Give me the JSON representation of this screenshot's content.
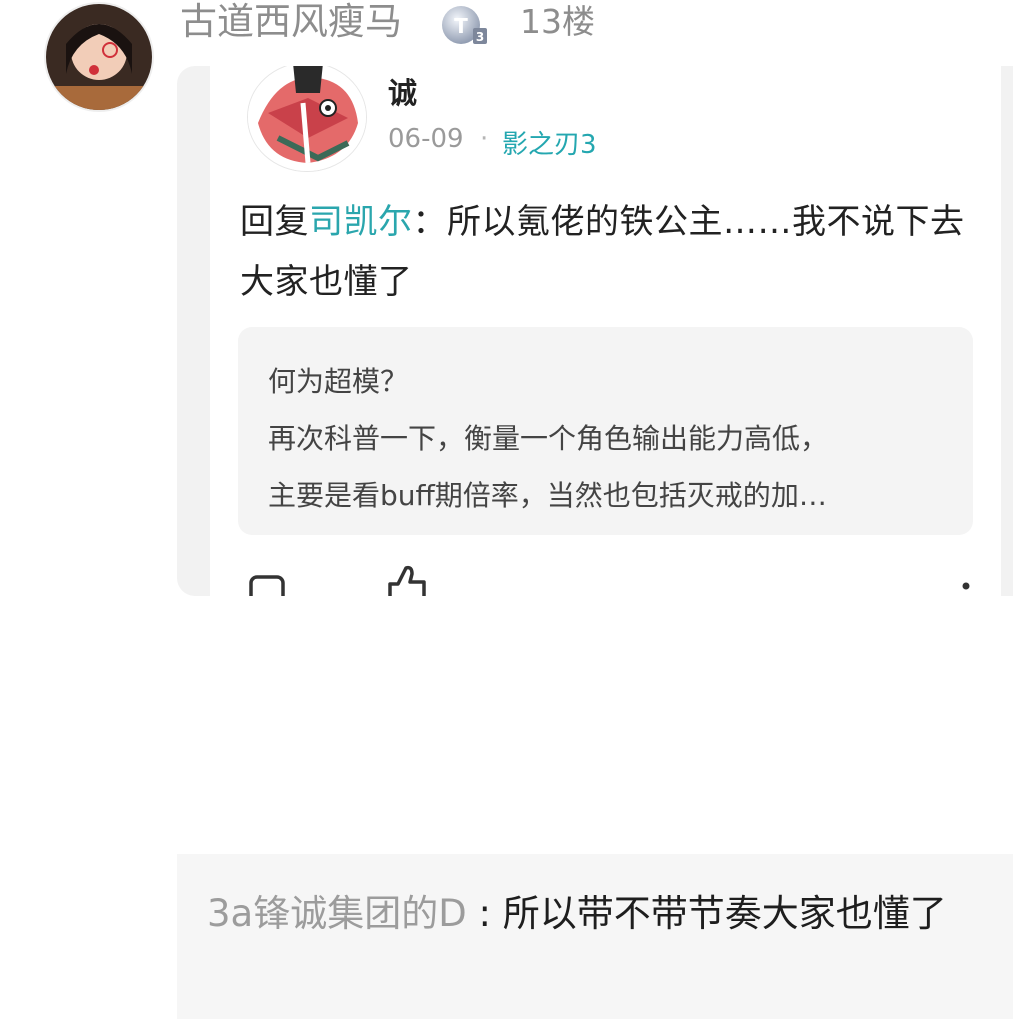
{
  "post": {
    "username": "古道西风瘦马",
    "level_badge": "T3",
    "floor": "13楼"
  },
  "quoted_comment": {
    "author": "诚",
    "date": "06-09",
    "separator": "·",
    "tag": "影之刃3",
    "reply_prefix": "回复",
    "reply_target": "司凯尔",
    "body": "：所以氪佬的铁公主……我不说下去大家也懂了",
    "quote_lines": [
      "何为超模？",
      "再次科普一下，衡量一个角色输出能力高低，",
      "主要是看buff期倍率，当然也包括灭戒的加…"
    ]
  },
  "reply": {
    "author": "3a锋诚集团的D",
    "separator": " : ",
    "text": "所以带不带节奏大家也懂了"
  },
  "colors": {
    "accent_teal": "#2aa6ad",
    "muted_gray": "#8d8d8d",
    "quote_bg": "#f4f4f4"
  },
  "icons": [
    "user-avatar",
    "level-badge-icon",
    "comment-icon",
    "thumbs-up-icon",
    "more-dot-icon"
  ]
}
